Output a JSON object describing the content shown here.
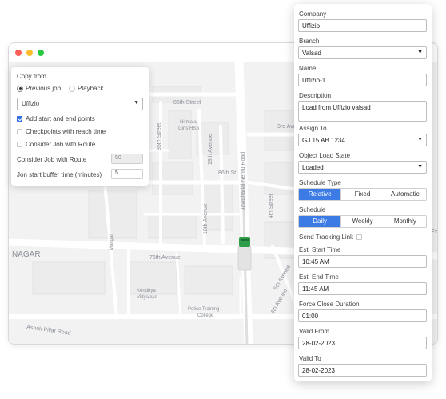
{
  "window": {
    "dots": [
      "#ff5f57",
      "#febc2e",
      "#28c840"
    ]
  },
  "map": {
    "labels": {
      "eighty_sixth_street": "86th Street",
      "eighty_sixth_st": "86th St",
      "third_ave": "3rd Ave",
      "nirmala": "Nirmala",
      "girls_hss": "Girls HSS",
      "eighty_fifth_street": "85th Street",
      "eighty_fourth_street": "84th Street",
      "nineteenth_avenue": "19th Avenue",
      "eighteenth_avenue": "18th Avenue",
      "jawaharlal_nehru_road": "Jawaharlal Nehru Road",
      "fourth_street": "4th Street",
      "mangal": "Mangal",
      "nagar": "NAGAR",
      "seventy_sixth_avenue": "76th Avenue",
      "fourth_avenue": "4th Avenue",
      "fifth_avenue": "5th Avenue",
      "kendriya": "Kendriya",
      "vidyalaya": "Vidyalaya",
      "police_training": "Police Training",
      "college": "College",
      "ashok_pillar_road": "Ashok Pillar Road",
      "edge_ex": "Ex"
    },
    "vehicle_color": "#2e9d4a"
  },
  "copy_from": {
    "title": "Copy from",
    "radio_previous": "Previous job",
    "radio_playback": "Playback",
    "company_select": "Uffizio",
    "chk_add_points": "Add start and end points",
    "chk_checkpoints": "Checkpoints with reach time",
    "chk_consider": "Consider Job with Route",
    "route_label": "Consider Job with Route",
    "route_value": "50",
    "buffer_label": "Jon start buffer time (minutes)",
    "buffer_value": "5"
  },
  "form": {
    "company_label": "Company",
    "company_value": "Uffizio",
    "branch_label": "Branch",
    "branch_value": "Valsad",
    "name_label": "Name",
    "name_value": "Uffizio-1",
    "description_label": "Description",
    "description_value": "Load from Uffizio valsad",
    "assign_label": "Assign To",
    "assign_value": "GJ 15 AB 1234",
    "object_state_label": "Object Load State",
    "object_state_value": "Loaded",
    "schedule_type_label": "Schedule Type",
    "schedule_type_options": [
      "Relative",
      "Fixed",
      "Automatic"
    ],
    "schedule_label": "Schedule",
    "schedule_options": [
      "Daily",
      "Weekly",
      "Monthly"
    ],
    "send_tracking_label": "Send Tracking Link",
    "est_start_label": "Est. Start Time",
    "est_start_value": "10:45 AM",
    "est_end_label": "Est. End Time",
    "est_end_value": "11:45 AM",
    "force_close_label": "Force Close Duration",
    "force_close_value": "01:00",
    "valid_from_label": "Valid From",
    "valid_from_value": "28-02-2023",
    "valid_to_label": "Valid To",
    "valid_to_value": "28-02-2023",
    "accent": "#3c7be6"
  }
}
